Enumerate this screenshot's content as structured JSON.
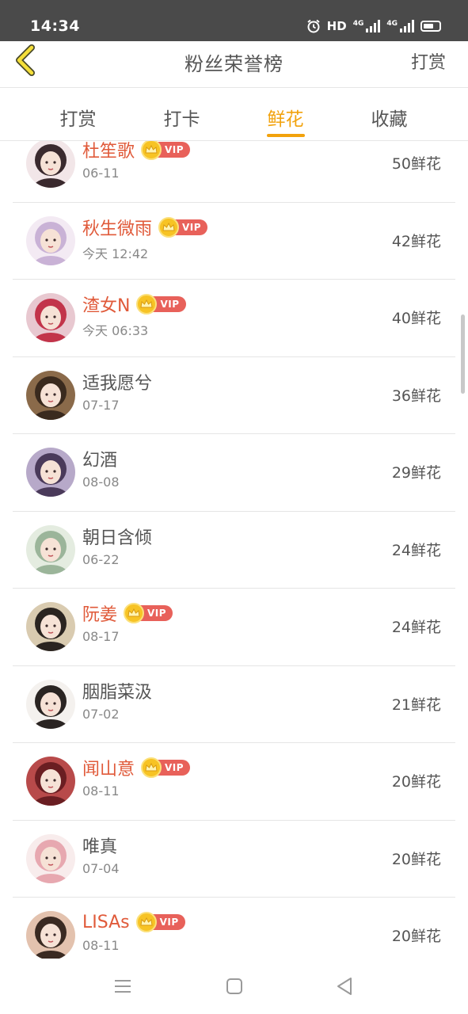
{
  "status_bar": {
    "time": "14:34",
    "network_label": "HD",
    "signal1_label": "4G",
    "signal2_label": "4G",
    "icons": [
      "alarm-icon",
      "hd-icon",
      "signal-icon",
      "signal-icon",
      "battery-icon"
    ]
  },
  "header": {
    "title": "粉丝荣誉榜",
    "action": "打赏",
    "back_icon": "chevron-left-icon"
  },
  "tabs": [
    {
      "label": "打赏",
      "active": false
    },
    {
      "label": "打卡",
      "active": false
    },
    {
      "label": "鲜花",
      "active": true
    },
    {
      "label": "收藏",
      "active": false
    }
  ],
  "vip_label": "VIP",
  "fans": [
    {
      "name": "杜笙歌",
      "vip": true,
      "date": "06-11",
      "flowers": "50鲜花",
      "avatar_colors": [
        "#f2e6e8",
        "#3a2a2e"
      ]
    },
    {
      "name": "秋生微雨",
      "vip": true,
      "date": "今天 12:42",
      "flowers": "42鲜花",
      "avatar_colors": [
        "#f3eaf3",
        "#c9b2d6"
      ]
    },
    {
      "name": "渣女N",
      "vip": true,
      "date": "今天 06:33",
      "flowers": "40鲜花",
      "avatar_colors": [
        "#e8c8d0",
        "#c2344a"
      ]
    },
    {
      "name": "适我愿兮",
      "vip": false,
      "date": "07-17",
      "flowers": "36鲜花",
      "avatar_colors": [
        "#8a6a4a",
        "#3a2a1e"
      ]
    },
    {
      "name": "幻酒",
      "vip": false,
      "date": "08-08",
      "flowers": "29鲜花",
      "avatar_colors": [
        "#b7a9c9",
        "#4a3a5a"
      ]
    },
    {
      "name": "朝日含倾",
      "vip": false,
      "date": "06-22",
      "flowers": "24鲜花",
      "avatar_colors": [
        "#e4ece0",
        "#9bb59a"
      ]
    },
    {
      "name": "阮姜",
      "vip": true,
      "date": "08-17",
      "flowers": "24鲜花",
      "avatar_colors": [
        "#d9cbb0",
        "#2a2420"
      ]
    },
    {
      "name": "胭脂菜汲",
      "vip": false,
      "date": "07-02",
      "flowers": "21鲜花",
      "avatar_colors": [
        "#f4f1ee",
        "#2a2422"
      ]
    },
    {
      "name": "闻山意",
      "vip": true,
      "date": "08-11",
      "flowers": "20鲜花",
      "avatar_colors": [
        "#b84a4a",
        "#6a1e22"
      ]
    },
    {
      "name": "唯真",
      "vip": false,
      "date": "07-04",
      "flowers": "20鲜花",
      "avatar_colors": [
        "#f8ecec",
        "#e7a8b0"
      ]
    },
    {
      "name": "LISAs",
      "vip": true,
      "date": "08-11",
      "flowers": "20鲜花",
      "avatar_colors": [
        "#e3c2ae",
        "#3a2a22"
      ]
    }
  ],
  "nav_bar": {
    "icons": [
      "menu-icon",
      "home-icon",
      "back-triangle-icon"
    ]
  }
}
